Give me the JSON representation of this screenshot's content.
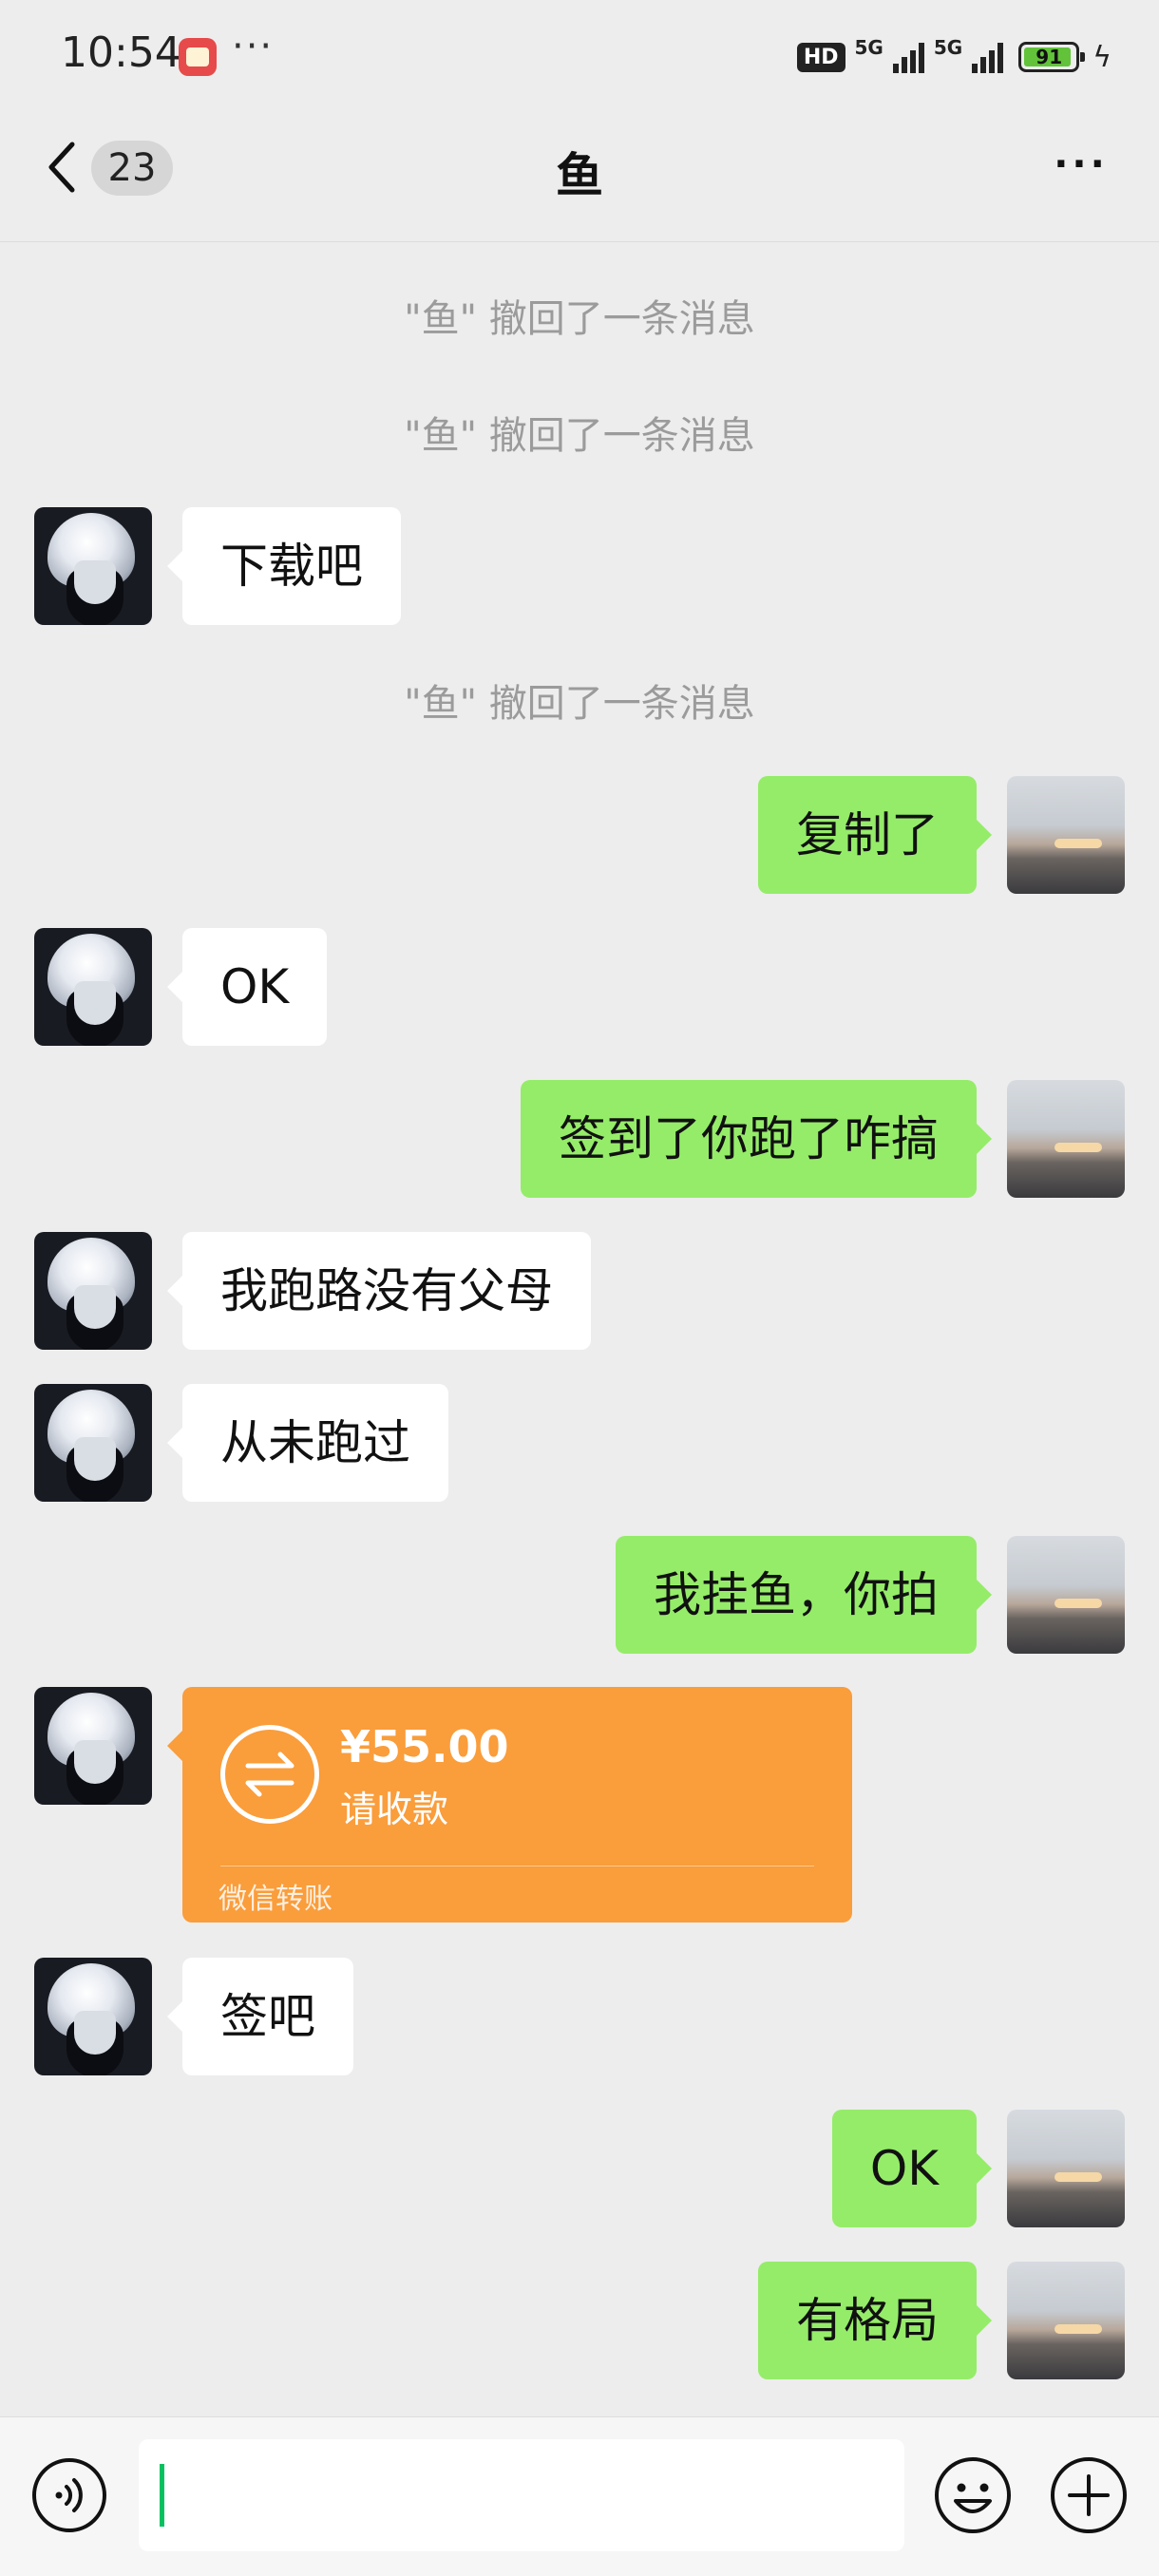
{
  "status_bar": {
    "time": "10:54",
    "dots": "···",
    "hd": "HD",
    "network_1": "5G",
    "network_2": "5G",
    "battery": "91",
    "charging_icon": "lightning-icon"
  },
  "header": {
    "unread_count": "23",
    "title": "鱼",
    "more_label": "···"
  },
  "messages": [
    {
      "type": "system",
      "text": "\"鱼\" 撤回了一条消息"
    },
    {
      "type": "system",
      "text": "\"鱼\" 撤回了一条消息"
    },
    {
      "type": "incoming",
      "text": "下载吧"
    },
    {
      "type": "system",
      "text": "\"鱼\" 撤回了一条消息"
    },
    {
      "type": "outgoing",
      "text": "复制了"
    },
    {
      "type": "incoming",
      "text": "OK"
    },
    {
      "type": "outgoing",
      "text": "签到了你跑了咋搞"
    },
    {
      "type": "incoming",
      "text": "我跑路没有父母"
    },
    {
      "type": "incoming",
      "text": "从未跑过"
    },
    {
      "type": "outgoing",
      "text": "我挂鱼，你拍"
    },
    {
      "type": "transfer",
      "amount": "¥55.00",
      "status": "请收款",
      "label": "微信转账"
    },
    {
      "type": "incoming",
      "text": "签吧"
    },
    {
      "type": "outgoing",
      "text": "OK"
    },
    {
      "type": "outgoing",
      "text": "有格局"
    }
  ],
  "input_bar": {
    "message_value": "",
    "voice_icon": "voice-icon",
    "emoji_icon": "emoji-icon",
    "plus_icon": "plus-icon"
  },
  "colors": {
    "background": "#ededed",
    "incoming_bubble": "#ffffff",
    "outgoing_bubble": "#95ec69",
    "transfer_card": "#fa9d3b",
    "system_text": "#9b9b9b",
    "cursor": "#07c160"
  }
}
